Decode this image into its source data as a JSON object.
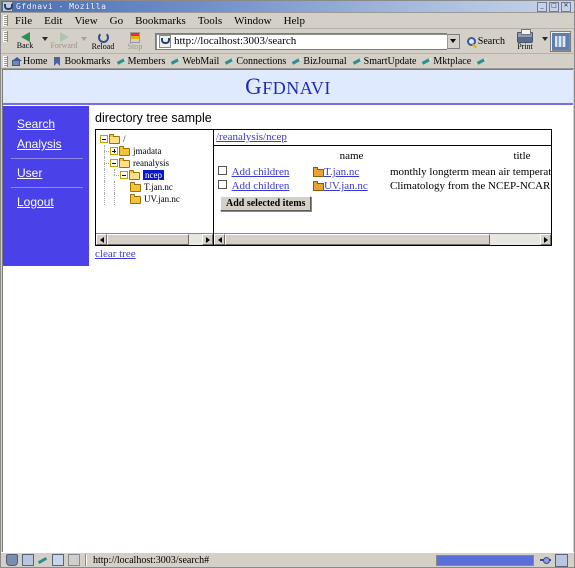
{
  "window": {
    "title": "Gfdnavi - Mozilla",
    "minimize_label": "_",
    "maximize_label": "□",
    "close_label": "✕"
  },
  "menubar": {
    "items": [
      "File",
      "Edit",
      "View",
      "Go",
      "Bookmarks",
      "Tools",
      "Window",
      "Help"
    ]
  },
  "toolbar": {
    "back_label": "Back",
    "forward_label": "Forward",
    "reload_label": "Reload",
    "stop_label": "Stop",
    "search_label": "Search",
    "print_label": "Print",
    "url_value": "http://localhost:3003/search"
  },
  "personal_bar": {
    "items": [
      "Home",
      "Bookmarks",
      "Members",
      "WebMail",
      "Connections",
      "BizJournal",
      "SmartUpdate",
      "Mktplace"
    ]
  },
  "banner": {
    "brand_first": "G",
    "brand_rest": "FDNAVI"
  },
  "sidebar": {
    "items": [
      {
        "label": "Search"
      },
      {
        "label": "Analysis"
      },
      {
        "label": "User"
      },
      {
        "label": "Logout"
      }
    ]
  },
  "content": {
    "heading": "directory tree sample",
    "clear_tree_label": "clear tree"
  },
  "tree": {
    "nodes": [
      {
        "label": "/",
        "depth": 0,
        "state": "open",
        "selected": false
      },
      {
        "label": "jmadata",
        "depth": 1,
        "state": "closed",
        "selected": false
      },
      {
        "label": "reanalysis",
        "depth": 1,
        "state": "open",
        "selected": false
      },
      {
        "label": "ncep",
        "depth": 2,
        "state": "open",
        "selected": true
      },
      {
        "label": "T.jan.nc",
        "depth": 3,
        "state": "leaf",
        "selected": false
      },
      {
        "label": "UV.jan.nc",
        "depth": 3,
        "state": "leaf",
        "selected": false
      }
    ]
  },
  "list": {
    "breadcrumb": "/reanalysis/ncep",
    "headers": [
      "name",
      "title"
    ],
    "rows": [
      {
        "checked": false,
        "add_label": "Add children",
        "name": "T.jan.nc",
        "title": "monthly longterm mean air temperature"
      },
      {
        "checked": false,
        "add_label": "Add children",
        "name": "UV.jan.nc",
        "title": "Climatology from the NCEP-NCAR reanalysis"
      }
    ],
    "add_selected_label": "Add selected items"
  },
  "statusbar": {
    "url": "http://localhost:3003/search#",
    "progress_percent": 100
  },
  "colors": {
    "sidebar_bg": "#4a41e8",
    "banner_bg": "#dfeaff",
    "brand": "#2229b8",
    "link": "#3a3ad0",
    "selection": "#0a16c8",
    "chrome": "#d4d0c8"
  }
}
